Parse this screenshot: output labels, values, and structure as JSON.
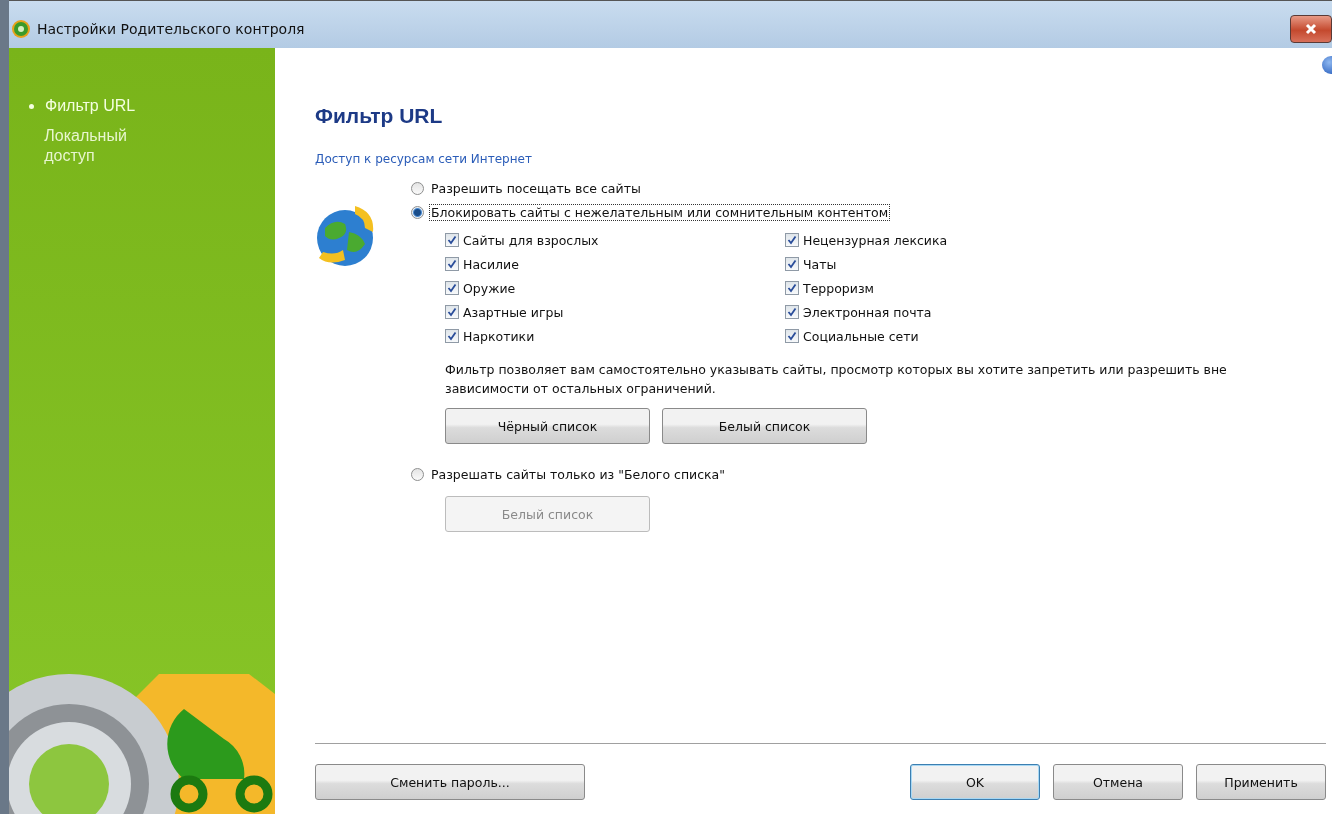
{
  "window": {
    "title": "Настройки Родительского контроля"
  },
  "sidebar": {
    "items": [
      {
        "label": "Фильтр URL",
        "selected": true
      },
      {
        "label": "Локальный доступ",
        "selected": false
      }
    ]
  },
  "page": {
    "title": "Фильтр URL",
    "section": "Доступ к ресурсам сети Интернет"
  },
  "modes": [
    {
      "label": "Разрешить посещать все сайты",
      "selected": false,
      "focused": false
    },
    {
      "label": "Блокировать сайты с нежелательным или сомнительным контентом",
      "selected": true,
      "focused": true,
      "categories": [
        {
          "label": "Сайты для взрослых",
          "checked": true
        },
        {
          "label": "Насилие",
          "checked": true
        },
        {
          "label": "Оружие",
          "checked": true
        },
        {
          "label": "Азартные игры",
          "checked": true
        },
        {
          "label": "Наркотики",
          "checked": true
        },
        {
          "label": "Нецензурная лексика",
          "checked": true
        },
        {
          "label": "Чаты",
          "checked": true
        },
        {
          "label": "Терроризм",
          "checked": true
        },
        {
          "label": "Электронная почта",
          "checked": true
        },
        {
          "label": "Социальные сети",
          "checked": true
        }
      ],
      "note": "Фильтр позволяет вам самостоятельно указывать сайты, просмотр которых вы хотите запретить или разрешить вне зависимости от остальных ограничений.",
      "buttons": [
        {
          "label": "Чёрный список",
          "disabled": false
        },
        {
          "label": "Белый список",
          "disabled": false
        }
      ]
    },
    {
      "label": "Разрешать сайты только из \"Белого списка\"",
      "selected": false,
      "focused": false,
      "buttons": [
        {
          "label": "Белый список",
          "disabled": true
        }
      ]
    }
  ],
  "footer": {
    "left": [
      {
        "label": "Сменить пароль...",
        "default": false
      }
    ],
    "right": [
      {
        "label": "OK",
        "default": true
      },
      {
        "label": "Отмена",
        "default": false
      },
      {
        "label": "Применить",
        "default": false
      }
    ]
  }
}
